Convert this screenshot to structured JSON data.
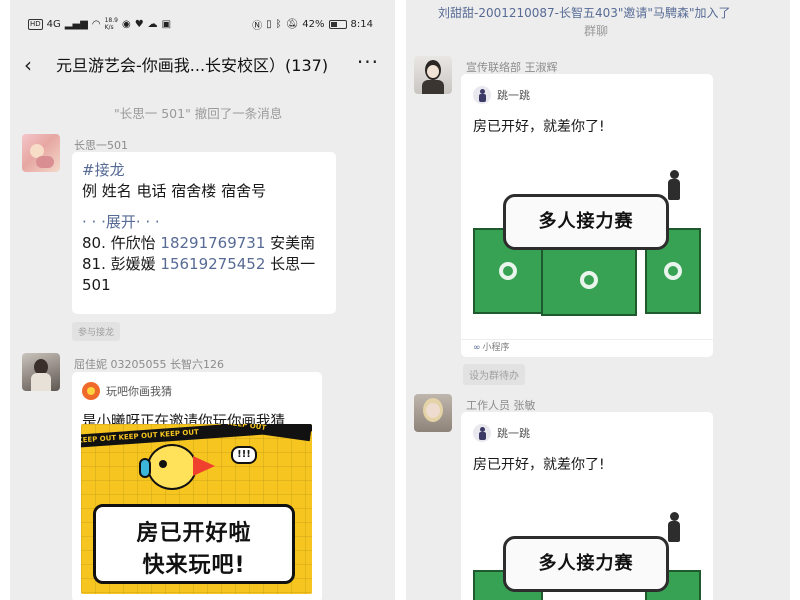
{
  "status_bar": {
    "network_label": "HD",
    "signal": "4G",
    "speed": "18.9",
    "speed_unit": "K/s",
    "battery": "42%",
    "time": "8:14"
  },
  "header": {
    "title": "元旦游艺会-你画我...长安校区）(137)",
    "back_icon": "chevron-left-icon",
    "more_icon": "more-dots-icon"
  },
  "left": {
    "recall_notice": "\"长思一 501\" 撤回了一条消息",
    "msg1": {
      "sender": "长思一501",
      "lines": [
        {
          "text": "#接龙",
          "kind": "link"
        },
        {
          "text": "例 姓名 电话 宿舍楼 宿舍号",
          "kind": "text"
        },
        {
          "text": "· · ·展开· · ·",
          "kind": "link"
        }
      ],
      "entry80": {
        "prefix": "80. 仵欣怡 ",
        "phone": "18291769731",
        "suffix": " 安美南"
      },
      "entry81": {
        "prefix": "81. 彭媛媛 ",
        "phone": "15619275452",
        "suffix": " 长思一"
      },
      "entry81_cont": "501",
      "reply_button": "参与接龙"
    },
    "msg2": {
      "sender": "屈佳妮 03205055 长智六126",
      "app_name": "玩吧你画我猜",
      "title": "是小曦呀正在邀请你玩你画我猜",
      "tape_text": "KEEP OUT  KEEP OUT  KEEP OUT",
      "tape_text2": "KEEP OUT",
      "bubble_badge": "!!!",
      "promo_line1": "房已开好啦",
      "promo_line2": "快来玩吧!"
    }
  },
  "right": {
    "join_notice_line1": "刘甜甜-2001210087-长智五403\"邀请\"马騁森\"加入了",
    "join_notice_line2": "群聊",
    "msg1": {
      "sender": "宣传联络部 王淑辉",
      "app_name": "跳一跳",
      "title": "房已开好，就差你了!",
      "card_text": "多人接力赛",
      "footer": "小程序",
      "pending_button": "设为群待办"
    },
    "msg2": {
      "sender": "工作人员 张敏",
      "app_name": "跳一跳",
      "title": "房已开好，就差你了!",
      "card_text": "多人接力赛"
    }
  },
  "colors": {
    "chat_bg": "#ededed",
    "link": "#576b95",
    "cube_green": "#37a253",
    "promo_yellow": "#f6c520"
  }
}
